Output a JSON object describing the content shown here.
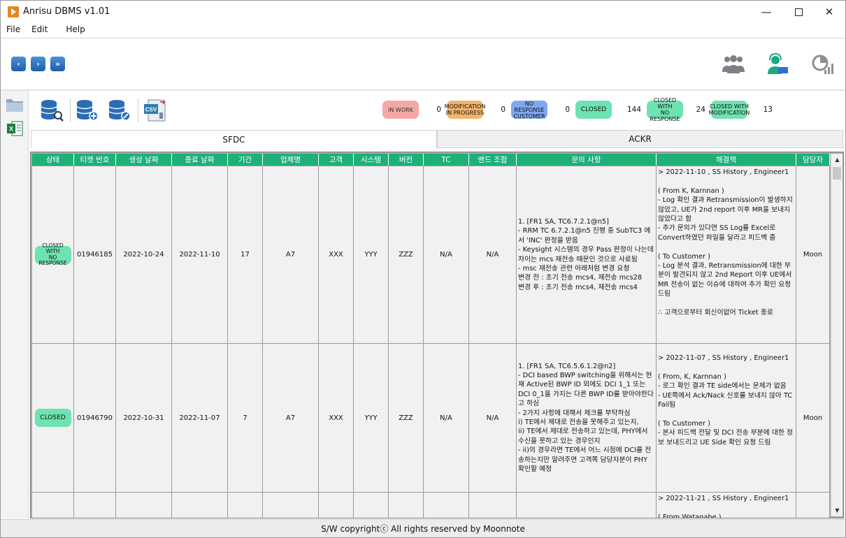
{
  "window": {
    "title": "Anrisu DBMS v1.01",
    "minimize": "—",
    "close": "✕"
  },
  "menu": [
    "File",
    "Edit",
    "Help"
  ],
  "nav": {
    "first": "‹",
    "next": "›",
    "last": "»"
  },
  "status": {
    "in_work": {
      "label": "IN WORK",
      "count": "0"
    },
    "modification": {
      "label_line1": "MODIFICATION",
      "label_line2": "IN PROGRESS",
      "count": "0"
    },
    "no_response": {
      "label_line1": "NO RESPONSE",
      "label_line2": "CUSTOMER",
      "count": "0"
    },
    "closed": {
      "label": "CLOSED",
      "count": "144"
    },
    "closed_no_response": {
      "label_line1": "CLOSED WITH",
      "label_line2": "NO RESPONSE",
      "count": "24"
    },
    "closed_modification": {
      "label_line1": "CLOSED WITH",
      "label_line2": "MODIFICATION",
      "count": "13"
    }
  },
  "toolbar": {
    "csv_label": "CSV"
  },
  "tabs": [
    "SFDC",
    "ACKR"
  ],
  "columns": [
    "상태",
    "티켓 번호",
    "생성 날짜",
    "종료 날짜",
    "기간",
    "업체명",
    "고객",
    "시스템",
    "버전",
    "TC",
    "밴드 조합",
    "문의 사항",
    "해결책",
    "담당자"
  ],
  "rows": [
    {
      "status_line1": "CLOSED WITH",
      "status_line2": "NO RESPONSE",
      "ticket": "01946185",
      "created": "2022-10-24",
      "closed": "2022-11-10",
      "duration": "17",
      "company": "A7",
      "customer": "XXX",
      "system": "YYY",
      "version": "ZZZ",
      "tc": "N/A",
      "band": "N/A",
      "inquiry": "1. [FR1 SA, TC6.7.2.1@n5]\n- RRM TC 6.7.2.1@n5 진행 중 SubTC3 에서 'INC' 판정을 받음\n- Keysight 시스템의 경우 Pass 판정이 나는데 차이는 mcs 재전송 때문인 것으로 사료됨\n- msc 재전송 관련 아래처럼 변경 요청\n변경 전 : 초기 전송 mcs4, 재전송 mcs28\n변경 후 : 초기 전송 mcs4, 재전송 mcs4",
      "solution": "> 2022-11-10 , SS History , Engineer1\n\n( From K, Karnnan )\n- Log 확인 결과 Retransmission이 발생하지 않았고, UE가 2nd report 이후 MR을 보내지 않았다고 함\n- 추가 문의가 있다면 SS Log를 Excel로 Convert하였던 파일을 달라고 피드백 줌\n\n( To Customer )\n- Log 분석 결과, Retransmission에 대한 부분이 발견되지 않고 2nd Report 이후 UE에서 MR 전송이 없는 이슈에 대하여 추가 확인 요청 드림\n\n ∴ 고객으로부터 회신이없어 Ticket 종료",
      "owner": "Moon"
    },
    {
      "status_line1": "CLOSED",
      "status_line2": "",
      "ticket": "01946790",
      "created": "2022-10-31",
      "closed": "2022-11-07",
      "duration": "7",
      "company": "A7",
      "customer": "XXX",
      "system": "YYY",
      "version": "ZZZ",
      "tc": "N/A",
      "band": "N/A",
      "inquiry": "1. [FR1 SA, TC6.5.6.1.2@n2]\n- DCI based BWP switching을 위해서는 현재 Active된 BWP ID 외에도 DCI 1_1 또는 DCI 0_1을 가지는 다른 BWP ID를 받아야한다고 하심\n- 2가지 사항에 대해서 체크를 부탁하심\n   i) TE에서 제대로 전송을 못해주고 있는지,\n   ii) TE에서 제대로 전송하고 있는데, PHY에서 수신을 못하고 있는 경우인지\n- ii)의 경우라면 TE에서 어느 시점에 DCI를 전송하는지만 알려주면 고객쪽 담당자분이 PHY 확인할 예정",
      "solution": "> 2022-11-07 , SS History , Engineer1\n\n( From, K, Karnnan )\n- 로그 확인 결과 TE side에서는 문제가 없음\n- UE쪽에서 Ack/Nack 신호를 보내지 않아 TC Fail됨\n\n( To Customer )\n- 본사 피드백 전달 및 DCI 전송 부분에 대한 정보 보내드리고 UE Side 확인 요청 드림",
      "owner": "Moon"
    },
    {
      "status_line1": "",
      "status_line2": "",
      "ticket": "",
      "created": "",
      "closed": "",
      "duration": "",
      "company": "",
      "customer": "",
      "system": "",
      "version": "",
      "tc": "",
      "band": "",
      "inquiry": "",
      "solution": "> 2022-11-21 , SS History , Engineer1\n\n( From Watanabe )",
      "owner": ""
    }
  ],
  "footer": "S/W copyrightⓒ All rights reserved by Moonnote",
  "colors": {
    "header_green": "#1eb079",
    "badge_green": "#6fe2b1",
    "in_work": "#f4a7a7",
    "modification": "#f2b36b",
    "no_response": "#7ea7ee"
  }
}
